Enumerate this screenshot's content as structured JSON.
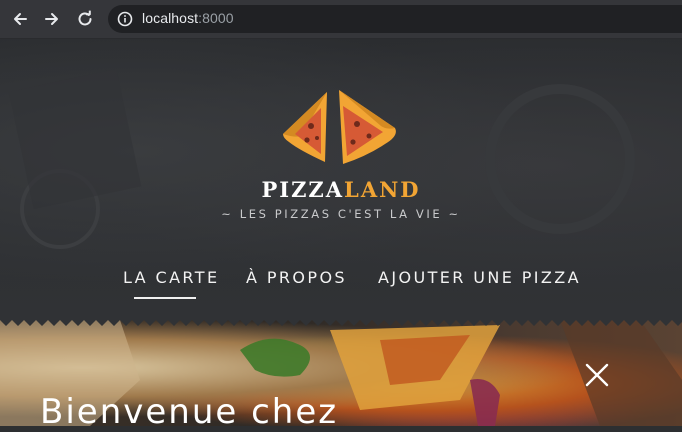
{
  "browser": {
    "url_host": "localhost",
    "url_port": ":8000",
    "icons": [
      "back-icon",
      "forward-icon",
      "reload-icon",
      "info-icon"
    ]
  },
  "site": {
    "brand_part1": "PIZZA",
    "brand_part2": "LAND",
    "tagline": "~ LES PIZZAS C'EST LA VIE ~",
    "accent_color": "#f2a534",
    "nav": [
      {
        "label": "LA CARTE",
        "active": true
      },
      {
        "label": "À PROPOS",
        "active": false
      },
      {
        "label": "AJOUTER UNE PIZZA",
        "active": false
      }
    ]
  },
  "carousel": {
    "heading": "Bienvenue chez",
    "close_icon": "close-icon"
  }
}
